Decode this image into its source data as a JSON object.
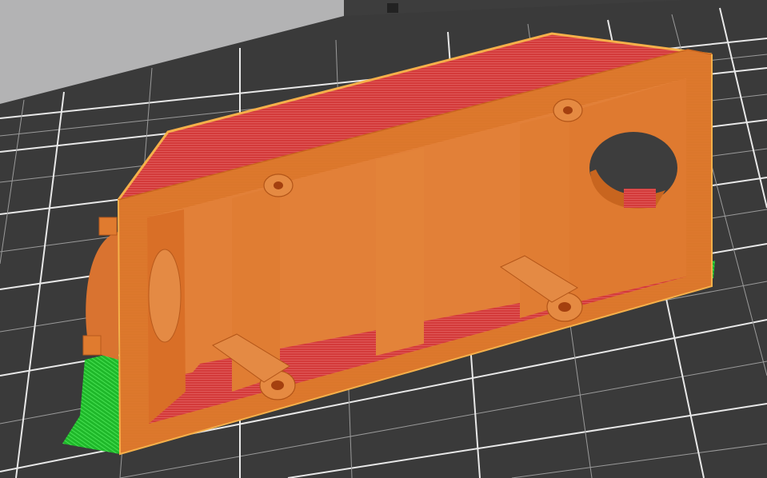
{
  "viewer": {
    "mode": "slice-preview",
    "bed_color": "#3c3c3c",
    "background_color": "#b2b2b3",
    "grid_color": "#e6e6e6",
    "perimeter_color": "#e07a2e",
    "infill_color": "#d43a3a",
    "support_color": "#22c32e",
    "edge_highlight_color": "#f5b04a",
    "icons": [
      "bed-grid-icon",
      "print-object-icon",
      "support-material-icon"
    ]
  }
}
